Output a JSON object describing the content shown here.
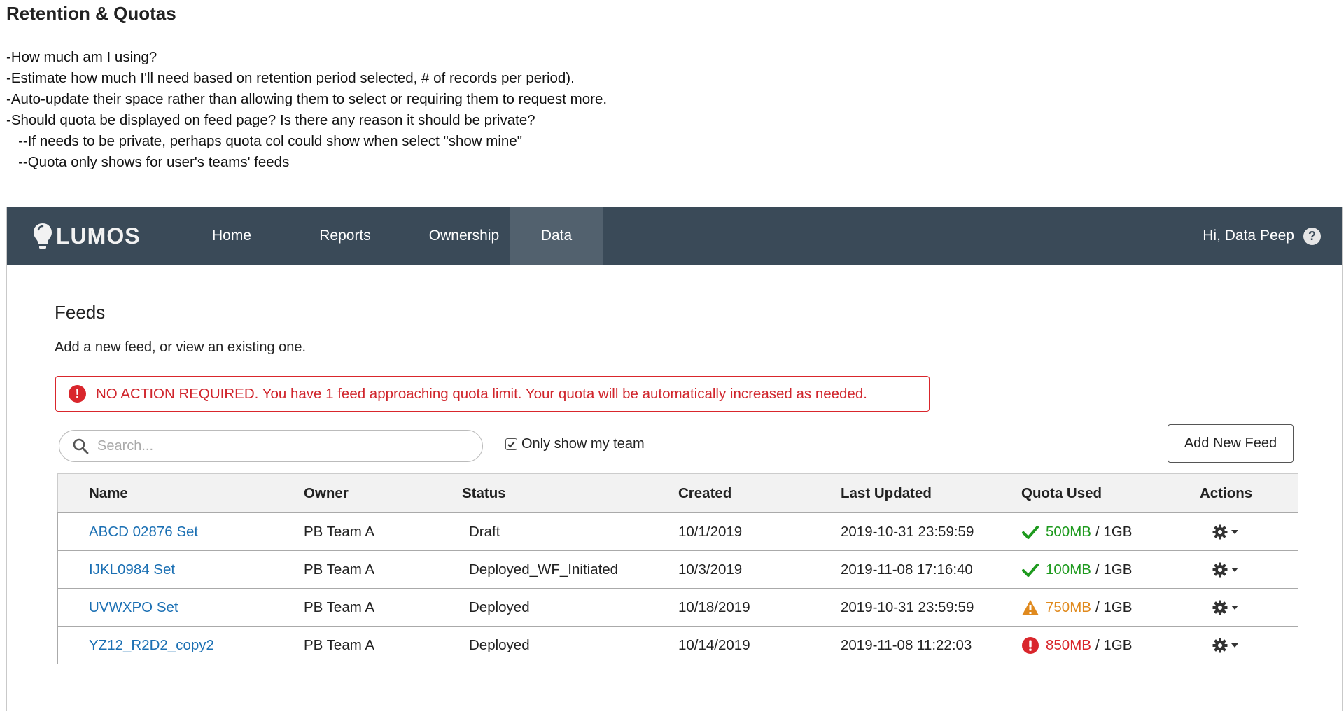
{
  "notes": {
    "title": "Retention & Quotas",
    "lines": [
      "-How much am I using?",
      "-Estimate how much I'll need based on retention period selected, # of records per period).",
      "-Auto-update their space rather than allowing them to select or requiring them to request more.",
      "-Should quota be displayed on feed page? Is there any reason it should be private?",
      "   --If needs to be private, perhaps quota col could show when select \"show mine\"",
      "   --Quota only shows for user's teams' feeds"
    ]
  },
  "nav": {
    "logo": "LUMOS",
    "items": [
      "Home",
      "Reports",
      "Ownership",
      "Data"
    ],
    "active": "Data",
    "greeting": "Hi, Data Peep"
  },
  "page": {
    "title": "Feeds",
    "subtitle": "Add a new feed, or view an existing one."
  },
  "alert": {
    "text": "NO ACTION REQUIRED. You have 1 feed approaching quota limit. Your quota will be automatically increased as needed."
  },
  "toolbar": {
    "search_placeholder": "Search...",
    "team_filter_label": "Only show my team",
    "team_filter_checked": true,
    "add_button": "Add New Feed"
  },
  "table": {
    "headers": [
      "Name",
      "Owner",
      "Status",
      "Created",
      "Last Updated",
      "Quota Used",
      "Actions"
    ],
    "rows": [
      {
        "name": "ABCD 02876 Set",
        "owner": "PB Team A",
        "status": "Draft",
        "created": "10/1/2019",
        "updated": "2019-10-31 23:59:59",
        "quota_used": "500MB",
        "quota_total": "1GB",
        "level": "ok"
      },
      {
        "name": "IJKL0984 Set",
        "owner": "PB Team A",
        "status": "Deployed_WF_Initiated",
        "created": "10/3/2019",
        "updated": "2019-11-08 17:16:40",
        "quota_used": "100MB",
        "quota_total": "1GB",
        "level": "ok"
      },
      {
        "name": "UVWXPO Set",
        "owner": "PB Team A",
        "status": "Deployed",
        "created": "10/18/2019",
        "updated": "2019-10-31 23:59:59",
        "quota_used": "750MB",
        "quota_total": "1GB",
        "level": "warning"
      },
      {
        "name": "YZ12_R2D2_copy2",
        "owner": "PB Team A",
        "status": "Deployed",
        "created": "10/14/2019",
        "updated": "2019-11-08 11:22:03",
        "quota_used": "850MB",
        "quota_total": "1GB",
        "level": "critical"
      }
    ]
  },
  "colors": {
    "nav_bg": "#3a4a58",
    "nav_active": "#52616e",
    "link": "#1a6fb3",
    "ok": "#1e9a1e",
    "warning": "#e08a1e",
    "critical": "#d9262c"
  },
  "icons": {
    "logo": "lightbulb-icon",
    "help": "question-circle-icon",
    "alert": "exclamation-circle-icon",
    "search": "search-icon",
    "ok": "checkmark-icon",
    "warning": "warning-triangle-icon",
    "critical": "exclamation-circle-icon",
    "actions": "gear-dropdown-icon"
  }
}
